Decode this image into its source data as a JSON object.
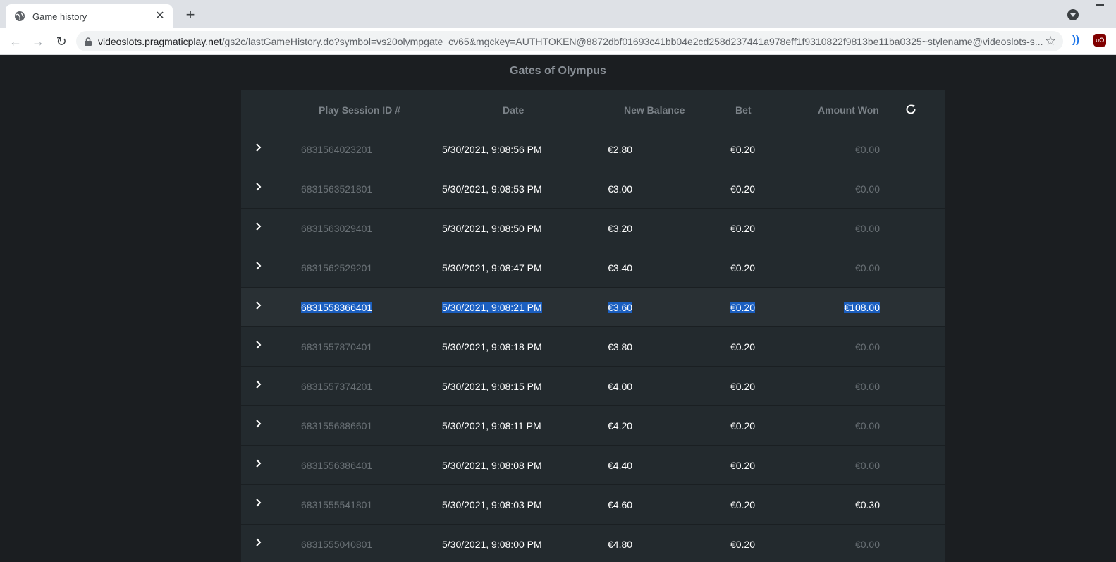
{
  "browser": {
    "tab_title": "Game history",
    "url_host": "videoslots.pragmaticplay.net",
    "url_path": "/gs2c/lastGameHistory.do?symbol=vs20olympgate_cv65&mgckey=AUTHTOKEN@8872dbf01693c41bb04e2cd258d237441a978eff1f9310822f9813be11ba0325~stylename@videoslots-s..."
  },
  "page": {
    "title": "Gates of Olympus"
  },
  "table": {
    "headers": {
      "session": "Play Session ID #",
      "date": "Date",
      "balance": "New Balance",
      "bet": "Bet",
      "won": "Amount Won"
    },
    "rows": [
      {
        "id": "6831564023201",
        "date": "5/30/2021, 9:08:56 PM",
        "balance": "€2.80",
        "bet": "€0.20",
        "won": "€0.00"
      },
      {
        "id": "6831563521801",
        "date": "5/30/2021, 9:08:53 PM",
        "balance": "€3.00",
        "bet": "€0.20",
        "won": "€0.00"
      },
      {
        "id": "6831563029401",
        "date": "5/30/2021, 9:08:50 PM",
        "balance": "€3.20",
        "bet": "€0.20",
        "won": "€0.00"
      },
      {
        "id": "6831562529201",
        "date": "5/30/2021, 9:08:47 PM",
        "balance": "€3.40",
        "bet": "€0.20",
        "won": "€0.00"
      },
      {
        "id": "6831558366401",
        "date": "5/30/2021, 9:08:21 PM",
        "balance": "€3.60",
        "bet": "€0.20",
        "won": "€108.00",
        "selected": true
      },
      {
        "id": "6831557870401",
        "date": "5/30/2021, 9:08:18 PM",
        "balance": "€3.80",
        "bet": "€0.20",
        "won": "€0.00"
      },
      {
        "id": "6831557374201",
        "date": "5/30/2021, 9:08:15 PM",
        "balance": "€4.00",
        "bet": "€0.20",
        "won": "€0.00"
      },
      {
        "id": "6831556886601",
        "date": "5/30/2021, 9:08:11 PM",
        "balance": "€4.20",
        "bet": "€0.20",
        "won": "€0.00"
      },
      {
        "id": "6831556386401",
        "date": "5/30/2021, 9:08:08 PM",
        "balance": "€4.40",
        "bet": "€0.20",
        "won": "€0.00"
      },
      {
        "id": "6831555541801",
        "date": "5/30/2021, 9:08:03 PM",
        "balance": "€4.60",
        "bet": "€0.20",
        "won": "€0.30"
      },
      {
        "id": "6831555040801",
        "date": "5/30/2021, 9:08:00 PM",
        "balance": "€4.80",
        "bet": "€0.20",
        "won": "€0.00"
      }
    ]
  },
  "colors": {
    "page_bg": "#1b1e21",
    "panel_bg": "#232a2e",
    "selection": "#1b5fc0"
  }
}
